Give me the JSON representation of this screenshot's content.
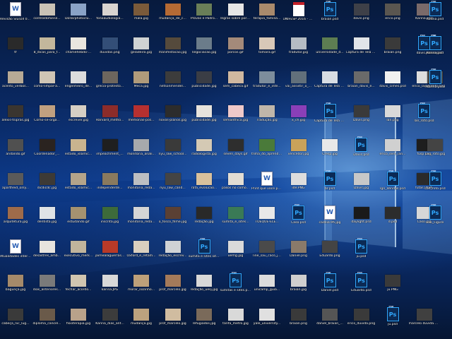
{
  "desktop": {
    "colors": {
      "doc": "#ffffff",
      "psd": "#0b2a55",
      "psd_accent": "#31a8ff"
    },
    "rows": [
      {
        "icons": [
          {
            "label": "Revisão Slusoll 092015.docx",
            "type": "doc"
          },
          {
            "label": "controldofonsil...",
            "type": "img",
            "color": "#c9c2b5"
          },
          {
            "label": "Dollarphotoclu...",
            "type": "img",
            "color": "#8aa3c6"
          },
          {
            "label": "fonoaudiologia...",
            "type": "img",
            "color": "#d9d4cf"
          },
          {
            "label": "mala.jpg",
            "type": "img",
            "color": "#7a5a3a"
          },
          {
            "label": "mudança_de_c...",
            "type": "img",
            "color": "#b56a34"
          },
          {
            "label": "Provas e Padrõ...",
            "type": "img",
            "color": "#6a7f58"
          },
          {
            "label": "regras sobre portugues.jpg",
            "type": "img",
            "color": "#e6e6e6"
          },
          {
            "label": "terapia_familia...",
            "type": "img",
            "color": "#a98a6c"
          },
          {
            "label": "UNIFESP 2016 - Manual do ca...",
            "type": "pdf"
          },
          {
            "label": "braian.psd",
            "type": "psd"
          },
          {
            "label": "davis.png",
            "type": "img",
            "color": "#3e4048"
          },
          {
            "label": "erico.png",
            "type": "img",
            "color": "#5a5650"
          },
          {
            "label": "Karina.png",
            "type": "img",
            "color": "#7a6a6a"
          },
          {
            "label": "Karina.psd",
            "type": "psd"
          }
        ]
      },
      {
        "icons": [
          {
            "label": "tf",
            "type": "img",
            "color": "#2a2a2a"
          },
          {
            "label": "8_dicas_para_f...",
            "type": "img",
            "color": "#c3b79c"
          },
          {
            "label": "charliehebdo-...",
            "type": "img",
            "color": "#e9e6df"
          },
          {
            "label": "duvidas.png",
            "type": "img",
            "color": "#334e77"
          },
          {
            "label": "geladeira.jpg",
            "type": "img",
            "color": "#cfd2d3"
          },
          {
            "label": "manifestacao.jpg",
            "type": "img",
            "color": "#554a3c"
          },
          {
            "label": "negociacao.jpg",
            "type": "img",
            "color": "#6b7c8a"
          },
          {
            "label": "porcos.gif",
            "type": "gif",
            "color": "#a48a7a"
          },
          {
            "label": "tomara.gif",
            "type": "gif",
            "color": "#d8c8b8"
          },
          {
            "label": "tradutor.jpg",
            "type": "img",
            "color": "#b5bcc4"
          },
          {
            "label": "universidade_d...",
            "type": "img",
            "color": "#5d7d52"
          },
          {
            "label": "Captura de Tela 2016-03-17 às...",
            "type": "img",
            "color": "#e1e4e8"
          },
          {
            "label": "braian.png",
            "type": "img",
            "color": "#3a3a3a"
          },
          {
            "label": "davis.psd",
            "type": "psd"
          },
          {
            "label": "erico.psd",
            "type": "psd"
          },
          {
            "label": "Karina.psd",
            "type": "psd"
          }
        ]
      },
      {
        "icons": [
          {
            "label": "acento_verbos...",
            "type": "img",
            "color": "#b7aa96"
          },
          {
            "label": "como-limpar-a...",
            "type": "img",
            "color": "#cfc5b5"
          },
          {
            "label": "engenheiro_de...",
            "type": "img",
            "color": "#dcdcdc"
          },
          {
            "label": "grecia-protesto...",
            "type": "img",
            "color": "#6d665e"
          },
          {
            "label": "Meca.jpg",
            "type": "img",
            "color": "#b09b7b"
          },
          {
            "label": "netsonmendel...",
            "type": "img",
            "color": "#3c3c3c"
          },
          {
            "label": "publicidade.jpg",
            "type": "img",
            "color": "#3a3d45"
          },
          {
            "label": "sem_cabeca.gif",
            "type": "gif",
            "color": "#d0b8a0"
          },
          {
            "label": "tradutor_e_inte...",
            "type": "img",
            "color": "#7d8d9c"
          },
          {
            "label": "vai_assistir_o_...",
            "type": "img",
            "color": "#62707b"
          },
          {
            "label": "Captura de Tela 2016-03-23 às...",
            "type": "img",
            "color": "#d8dde3"
          },
          {
            "label": "braian_davis_e...",
            "type": "img",
            "color": "#6a6a6a"
          },
          {
            "label": "davis_cimes.psd",
            "type": "img",
            "color": "#f0f0f0"
          },
          {
            "label": "erico_lan_kar...",
            "type": "img",
            "color": "#dddddd"
          },
          {
            "label": "jan_roto.png",
            "type": "img",
            "color": "#4a4a4a"
          },
          {
            "label": "Karina.psd",
            "type": "psd"
          }
        ]
      },
      {
        "icons": [
          {
            "label": "alexis-tsipras.jpg",
            "type": "img",
            "color": "#3a3530"
          },
          {
            "label": "Como-se-orga...",
            "type": "img",
            "color": "#c0a080"
          },
          {
            "label": "escrever.jpg",
            "type": "img",
            "color": "#d6cfc4"
          },
          {
            "label": "Harvard_metho...",
            "type": "img",
            "color": "#8c2c2a"
          },
          {
            "label": "memorias-pos...",
            "type": "img",
            "color": "#b63030"
          },
          {
            "label": "novos-planos.jpg",
            "type": "img",
            "color": "#2c2c2c"
          },
          {
            "label": "publicidade.jpg",
            "type": "img",
            "color": "#e7e3dc"
          },
          {
            "label": "semanthica.jpg",
            "type": "img",
            "color": "#efc9c9"
          },
          {
            "label": "Tradução.jpg",
            "type": "img",
            "color": "#bfb6aa"
          },
          {
            "label": "x_ch.jpg",
            "type": "img",
            "color": "#8a3fb8"
          },
          {
            "label": "Captura de Tela 2016-03-23 às...",
            "type": "psd"
          },
          {
            "label": "Davis.png",
            "type": "img",
            "color": "#3a3a3a"
          },
          {
            "label": "lan.png",
            "type": "img",
            "color": "#d9d9d9"
          },
          {
            "label": "lan_roto.psd",
            "type": "psd"
          }
        ]
      },
      {
        "icons": [
          {
            "label": "andando.gif",
            "type": "gif",
            "color": "#505050"
          },
          {
            "label": "Coordenador_...",
            "type": "img",
            "color": "#2a2320"
          },
          {
            "label": "estado_islamic...",
            "type": "img",
            "color": "#c9b48f"
          },
          {
            "label": "impeachment_...",
            "type": "img",
            "color": "#1f1f1f"
          },
          {
            "label": "monitoria_anali...",
            "type": "img",
            "color": "#a7a9ac"
          },
          {
            "label": "nyu_law_school...",
            "type": "img",
            "color": "#3a3a3a"
          },
          {
            "label": "radiologista.jpg",
            "type": "img",
            "color": "#d4c9b4"
          },
          {
            "label": "seven_days.gif",
            "type": "gif",
            "color": "#2e2e2e"
          },
          {
            "label": "trilha_do_aprendiz...",
            "type": "img",
            "color": "#4a7a3a"
          },
          {
            "label": "vencedor.jpg",
            "type": "img",
            "color": "#c9a25a"
          },
          {
            "label": "Cresp.jpg",
            "type": "img",
            "color": "#e8e8e8"
          },
          {
            "label": "Davis.psd",
            "type": "psd"
          },
          {
            "label": "erico_sem_lan...",
            "type": "img",
            "color": "#d0d0d0"
          },
          {
            "label": "fusp.png",
            "type": "img",
            "color": "#1e1e1e"
          },
          {
            "label": "Lan_roto.jpg",
            "type": "img",
            "color": "#444444"
          }
        ]
      },
      {
        "icons": [
          {
            "label": "apartheid_only...",
            "type": "img",
            "color": "#5a5a5a"
          },
          {
            "label": "dicdicdc.jpg",
            "type": "img",
            "color": "#3d3a36"
          },
          {
            "label": "estado_islamic...",
            "type": "img",
            "color": "#b4a48a"
          },
          {
            "label": "independente...",
            "type": "img",
            "color": "#8a7a5e"
          },
          {
            "label": "monitoria_reda...",
            "type": "img",
            "color": "#bdbfc2"
          },
          {
            "label": "nyu_law_cand...",
            "type": "img",
            "color": "#444444"
          },
          {
            "label": "rafa_evolucao...",
            "type": "img",
            "color": "#d9c19c"
          },
          {
            "label": "pasos no como...",
            "type": "img",
            "color": "#e2ddd3"
          },
          {
            "label": "Print que voce pode de lado...",
            "type": "doc"
          },
          {
            "label": "ide.PNG",
            "type": "img",
            "color": "#dddddd"
          },
          {
            "label": "br.psd",
            "type": "psd"
          },
          {
            "label": "Davis.jpg",
            "type": "img",
            "color": "#c8c8c8"
          },
          {
            "label": "lgn_Vendas.psd",
            "type": "psd"
          },
          {
            "label": "futas.PAB6",
            "type": "img",
            "color": "#2a2a2a"
          },
          {
            "label": "Lan_roto.psd",
            "type": "psd"
          }
        ]
      },
      {
        "icons": [
          {
            "label": "arquitetura.jpg",
            "type": "img",
            "color": "#9e6b4a"
          },
          {
            "label": "dentista.jpg",
            "type": "img",
            "color": "#dfe3e6"
          },
          {
            "label": "estudando.gif",
            "type": "gif",
            "color": "#a59270"
          },
          {
            "label": "inscrita.jpg",
            "type": "img",
            "color": "#3d6b3a"
          },
          {
            "label": "monitoria_reda...",
            "type": "img",
            "color": "#d5d5d5"
          },
          {
            "label": "o_fosco_filme.jpg",
            "type": "img",
            "color": "#5a4034"
          },
          {
            "label": "redação.jpg",
            "type": "img",
            "color": "#292929"
          },
          {
            "label": "sumita_e_sites...",
            "type": "img",
            "color": "#3a7a56"
          },
          {
            "label": "TOEQUE-ELE...",
            "type": "img",
            "color": "#e8e8e8"
          },
          {
            "label": "Caso.psd",
            "type": "psd"
          },
          {
            "label": "cadeia-PA.jpg",
            "type": "doc"
          },
          {
            "label": "daylight.psd",
            "type": "img",
            "color": "#1a1a1a"
          },
          {
            "label": "d.psd",
            "type": "img",
            "color": "#2c2c2c"
          },
          {
            "label": "Caso.jpg",
            "type": "img",
            "color": "#d7d7d7"
          },
          {
            "label": "Lab_Figure",
            "type": "psd"
          }
        ]
      },
      {
        "icons": [
          {
            "label": "Atualidades internacionais_...",
            "type": "doc"
          },
          {
            "label": "desastres_amb...",
            "type": "img",
            "color": "#e7e4de"
          },
          {
            "label": "executivo_merk...",
            "type": "img",
            "color": "#c0b49c"
          },
          {
            "label": "jaimealaguerras...",
            "type": "img",
            "color": "#b83a28"
          },
          {
            "label": "Oxford_e_retam...",
            "type": "img",
            "color": "#d9cfbf"
          },
          {
            "label": "redação_escrev...",
            "type": "img",
            "color": "#cfd2d5"
          },
          {
            "label": "sumita e sites sites.psd",
            "type": "psd"
          },
          {
            "label": "uemg.jpg",
            "type": "img",
            "color": "#dadada"
          },
          {
            "label": "line_sau_caco_j...",
            "type": "img",
            "color": "#4a4a4a"
          },
          {
            "label": "Daniel.png",
            "type": "img",
            "color": "#8a7a6a"
          },
          {
            "label": "Eduardo.png",
            "type": "img",
            "color": "#444444"
          },
          {
            "label": "ju.psd",
            "type": "psd"
          }
        ]
      },
      {
        "icons": [
          {
            "label": "bagunça.jpg",
            "type": "img",
            "color": "#a58a6a"
          },
          {
            "label": "dias_anteriores...",
            "type": "img",
            "color": "#7a7a7a"
          },
          {
            "label": "fechar_acordo...",
            "type": "img",
            "color": "#d0c5b0"
          },
          {
            "label": "karina.JPG",
            "type": "img",
            "color": "#d8d8d8"
          },
          {
            "label": "morar_sozinho...",
            "type": "img",
            "color": "#bda07a"
          },
          {
            "label": "prof_marcelo.jpg",
            "type": "img",
            "color": "#a47a5a"
          },
          {
            "label": "redação_uesj.jpg",
            "type": "img",
            "color": "#d8d8d8"
          },
          {
            "label": "sumitas e sites.psd",
            "type": "psd"
          },
          {
            "label": "unicamp_guia...",
            "type": "img",
            "color": "#dcdcdc"
          },
          {
            "label": "braian.jpg",
            "type": "img",
            "color": "#cfcfcf"
          },
          {
            "label": "Daniel.psd",
            "type": "psd"
          },
          {
            "label": "Eduardo.psd",
            "type": "psd"
          },
          {
            "label": "ju.PNG",
            "type": "img",
            "color": "#3a3a3a"
          }
        ]
      },
      {
        "icons": [
          {
            "label": "cabeça_nic_lug...",
            "type": "img",
            "color": "#3a3a3a"
          },
          {
            "label": "diploma_cancel...",
            "type": "img",
            "color": "#6a5a4a"
          },
          {
            "label": "fisioterapia.jpg",
            "type": "img",
            "color": "#b9a28a"
          },
          {
            "label": "Karina_dias_ant...",
            "type": "img",
            "color": "#3c3c3c"
          },
          {
            "label": "mudança.jpg",
            "type": "img",
            "color": "#bca27e"
          },
          {
            "label": "prof_marcelo.jpg",
            "type": "img",
            "color": "#d0bca0"
          },
          {
            "label": "refugiados.jpg",
            "type": "img",
            "color": "#7a6a5a"
          },
          {
            "label": "tarifa_metro.jpg",
            "type": "img",
            "color": "#d9d9d9"
          },
          {
            "label": "yale_university...",
            "type": "img",
            "color": "#e0e0e0"
          },
          {
            "label": "braian.png",
            "type": "img",
            "color": "#3a3a3a"
          },
          {
            "label": "daniel_braian_...",
            "type": "img",
            "color": "#555555"
          },
          {
            "label": "erico_duvida.png",
            "type": "img",
            "color": "#3a3a3a"
          },
          {
            "label": "ju.psd",
            "type": "psd"
          },
          {
            "label": "marcelo duvida.png",
            "type": "img",
            "color": "#404040"
          }
        ]
      }
    ]
  }
}
